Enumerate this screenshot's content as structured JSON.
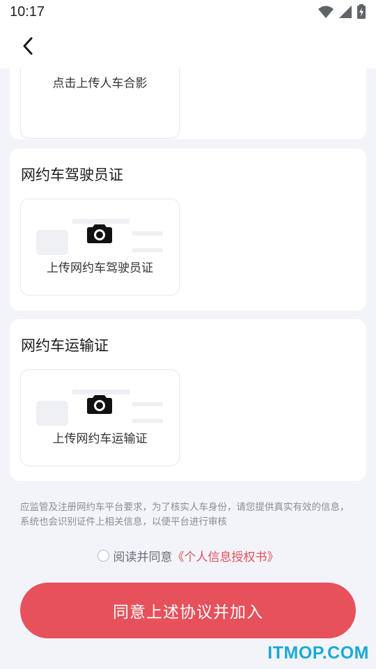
{
  "status_bar": {
    "time": "10:17"
  },
  "cards": [
    {
      "upload_label": "点击上传人车合影"
    },
    {
      "title": "网约车驾驶员证",
      "upload_label": "上传网约车驾驶员证"
    },
    {
      "title": "网约车运输证",
      "upload_label": "上传网约车运输证"
    }
  ],
  "notice": "应监管及注册网约车平台要求，为了核实人车身份，请您提供真实有效的信息，系统也会识别证件上相关信息，以便平台进行审核",
  "agreement": {
    "prefix": "阅读并同意",
    "link": "《个人信息授权书》"
  },
  "join_button": "同意上述协议并加入",
  "watermark": "ITMOP.COM",
  "colors": {
    "accent": "#e6515b",
    "link": "#e0505a",
    "background": "#f3f4f9"
  }
}
